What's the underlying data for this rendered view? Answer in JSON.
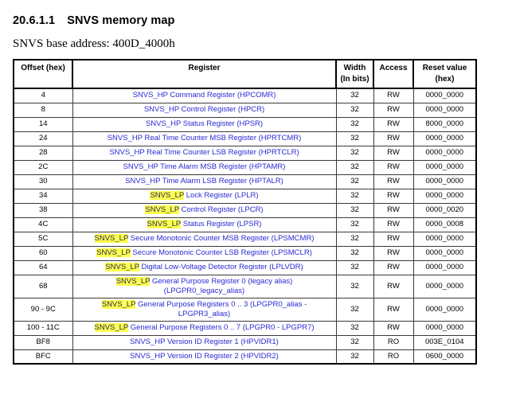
{
  "title": {
    "section_number": "20.6.1.1",
    "text": "SNVS memory map"
  },
  "subtitle": "SNVS base address: 400D_4000h",
  "colors": {
    "link_blue": "#2a2ad2",
    "highlight_yellow": "#ffff4d",
    "highlight_text": "#26265a"
  },
  "table": {
    "headers": {
      "offset": "Offset (hex)",
      "register": "Register",
      "width_line1": "Width",
      "width_line2": "(In bits)",
      "access": "Access",
      "reset_line1": "Reset value",
      "reset_line2": "(hex)"
    },
    "rows": [
      {
        "offset": "4",
        "highlight": "",
        "register": "SNVS_HP Command Register (HPCOMR)",
        "width": "32",
        "access": "RW",
        "reset": "0000_0000"
      },
      {
        "offset": "8",
        "highlight": "",
        "register": "SNVS_HP Control Register (HPCR)",
        "width": "32",
        "access": "RW",
        "reset": "0000_0000"
      },
      {
        "offset": "14",
        "highlight": "",
        "register": "SNVS_HP Status Register (HPSR)",
        "width": "32",
        "access": "RW",
        "reset": "8000_0000"
      },
      {
        "offset": "24",
        "highlight": "",
        "register": "SNVS_HP Real Time Counter MSB Register (HPRTCMR)",
        "width": "32",
        "access": "RW",
        "reset": "0000_0000"
      },
      {
        "offset": "28",
        "highlight": "",
        "register": "SNVS_HP Real Time Counter LSB Register (HPRTCLR)",
        "width": "32",
        "access": "RW",
        "reset": "0000_0000"
      },
      {
        "offset": "2C",
        "highlight": "",
        "register": "SNVS_HP Time Alarm MSB Register (HPTAMR)",
        "width": "32",
        "access": "RW",
        "reset": "0000_0000"
      },
      {
        "offset": "30",
        "highlight": "",
        "register": "SNVS_HP Time Alarm LSB Register (HPTALR)",
        "width": "32",
        "access": "RW",
        "reset": "0000_0000"
      },
      {
        "offset": "34",
        "highlight": "SNVS_LP",
        "register": " Lock Register (LPLR)",
        "width": "32",
        "access": "RW",
        "reset": "0000_0000"
      },
      {
        "offset": "38",
        "highlight": "SNVS_LP",
        "register": " Control Register (LPCR)",
        "width": "32",
        "access": "RW",
        "reset": "0000_0020"
      },
      {
        "offset": "4C",
        "highlight": "SNVS_LP",
        "register": " Status Register (LPSR)",
        "width": "32",
        "access": "RW",
        "reset": "0000_0008"
      },
      {
        "offset": "5C",
        "highlight": "SNVS_LP",
        "register": " Secure Monotonic Counter MSB Register (LPSMCMR)",
        "width": "32",
        "access": "RW",
        "reset": "0000_0000"
      },
      {
        "offset": "60",
        "highlight": "SNVS_LP",
        "register": " Secure Monotonic Counter LSB Register (LPSMCLR)",
        "width": "32",
        "access": "RW",
        "reset": "0000_0000"
      },
      {
        "offset": "64",
        "highlight": "SNVS_LP",
        "register": " Digital Low-Voltage Detector Register (LPLVDR)",
        "width": "32",
        "access": "RW",
        "reset": "0000_0000"
      },
      {
        "offset": "68",
        "highlight": "SNVS_LP",
        "register": " General Purpose Register 0 (legacy alias) (LPGPR0_legacy_alias)",
        "width": "32",
        "access": "RW",
        "reset": "0000_0000"
      },
      {
        "offset": "90 - 9C",
        "highlight": "SNVS_LP",
        "register": " General Purpose Registers 0 .. 3 (LPGPR0_alias - LPGPR3_alias)",
        "width": "32",
        "access": "RW",
        "reset": "0000_0000"
      },
      {
        "offset": "100 - 11C",
        "highlight": "SNVS_LP",
        "register": " General Purpose Registers 0 .. 7 (LPGPR0 - LPGPR7)",
        "width": "32",
        "access": "RW",
        "reset": "0000_0000"
      },
      {
        "offset": "BF8",
        "highlight": "",
        "register": "SNVS_HP Version ID Register 1 (HPVIDR1)",
        "width": "32",
        "access": "RO",
        "reset": "003E_0104"
      },
      {
        "offset": "BFC",
        "highlight": "",
        "register": "SNVS_HP Version ID Register 2 (HPVIDR2)",
        "width": "32",
        "access": "RO",
        "reset": "0600_0000"
      }
    ]
  }
}
